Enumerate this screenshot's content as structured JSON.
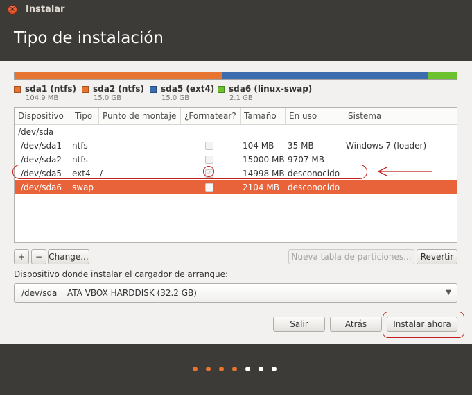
{
  "window": {
    "title": "Instalar"
  },
  "header": {
    "title": "Tipo de instalación"
  },
  "partition_bar": {
    "segments": [
      {
        "name": "sda1 (ntfs)",
        "size": "104.9 MB",
        "color": "#e8752f",
        "fraction": 0.003
      },
      {
        "name": "sda2 (ntfs)",
        "size": "15.0 GB",
        "color": "#e8752f",
        "fraction": 0.466
      },
      {
        "name": "sda5 (ext4)",
        "size": "15.0 GB",
        "color": "#3b6cae",
        "fraction": 0.466
      },
      {
        "name": "sda6 (linux-swap)",
        "size": "2.1 GB",
        "color": "#6cc12e",
        "fraction": 0.065
      }
    ]
  },
  "legend": [
    {
      "name": "sda1 (ntfs)",
      "size": "104.9 MB",
      "color": "#e8752f"
    },
    {
      "name": "sda2 (ntfs)",
      "size": "15.0 GB",
      "color": "#e8752f"
    },
    {
      "name": "sda5 (ext4)",
      "size": "15.0 GB",
      "color": "#3b6cae"
    },
    {
      "name": "sda6 (linux-swap)",
      "size": "2.1 GB",
      "color": "#6cc12e"
    }
  ],
  "table": {
    "columns": [
      "Dispositivo",
      "Tipo",
      "Punto de montaje",
      "¿Formatear?",
      "Tamaño",
      "En uso",
      "Sistema"
    ],
    "group": "/dev/sda",
    "rows": [
      {
        "device": "/dev/sda1",
        "type": "ntfs",
        "mount": "",
        "format": false,
        "size": "104 MB",
        "used": "35 MB",
        "system": "Windows 7 (loader)",
        "selected": false
      },
      {
        "device": "/dev/sda2",
        "type": "ntfs",
        "mount": "",
        "format": false,
        "size": "15000 MB",
        "used": "9707 MB",
        "system": "",
        "selected": false
      },
      {
        "device": "/dev/sda5",
        "type": "ext4",
        "mount": "/",
        "format": true,
        "size": "14998 MB",
        "used": "desconocido",
        "system": "",
        "selected": false
      },
      {
        "device": "/dev/sda6",
        "type": "swap",
        "mount": "",
        "format": false,
        "size": "2104 MB",
        "used": "desconocido",
        "system": "",
        "selected": true
      }
    ]
  },
  "toolbar": {
    "add_label": "+",
    "remove_label": "−",
    "change_label": "Change...",
    "new_table_label": "Nueva tabla de particiones...",
    "revert_label": "Revertir"
  },
  "bootloader": {
    "label": "Dispositivo donde instalar el cargador de arranque:",
    "device": "/dev/sda",
    "description": "ATA VBOX HARDDISK (32.2 GB)"
  },
  "actions": {
    "quit_label": "Salir",
    "back_label": "Atrás",
    "install_label": "Instalar ahora"
  },
  "progress": {
    "steps_total": 7,
    "steps_done": 4,
    "done_color": "#e8752f",
    "todo_color": "#ffffff"
  },
  "colors": {
    "selection": "#e8633a",
    "annotation": "#c0211f"
  }
}
